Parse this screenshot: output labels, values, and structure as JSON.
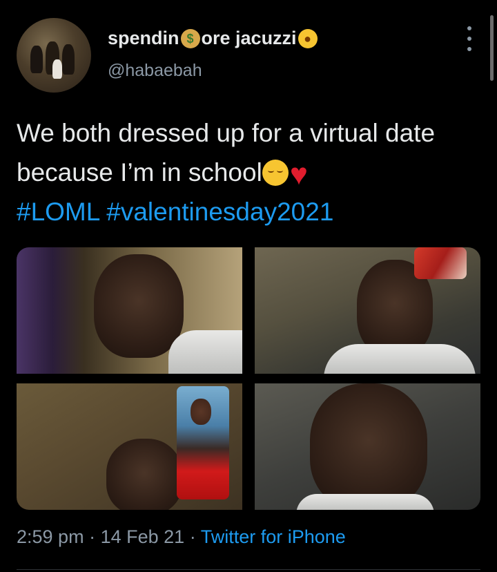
{
  "user": {
    "display_name_part1": "spendin",
    "display_name_emoji1": "💰",
    "display_name_part2": "ore jacuzzi",
    "display_name_emoji2": "🤪",
    "handle": "@habaebah"
  },
  "tweet": {
    "text_line": "We both dressed up for a virtual date because I’m in school",
    "emojis": [
      "relieved-face",
      "red-heart"
    ],
    "hashtags": [
      "#LOML",
      "#valentinesday2021"
    ]
  },
  "media": {
    "photo_count": 4
  },
  "footer": {
    "time": "2:59 pm",
    "date": "14 Feb 21",
    "separator": "·",
    "source": "Twitter for iPhone"
  },
  "colors": {
    "background": "#000000",
    "text": "#e7e9ea",
    "secondary": "#8b98a5",
    "link": "#1d9bf0"
  }
}
